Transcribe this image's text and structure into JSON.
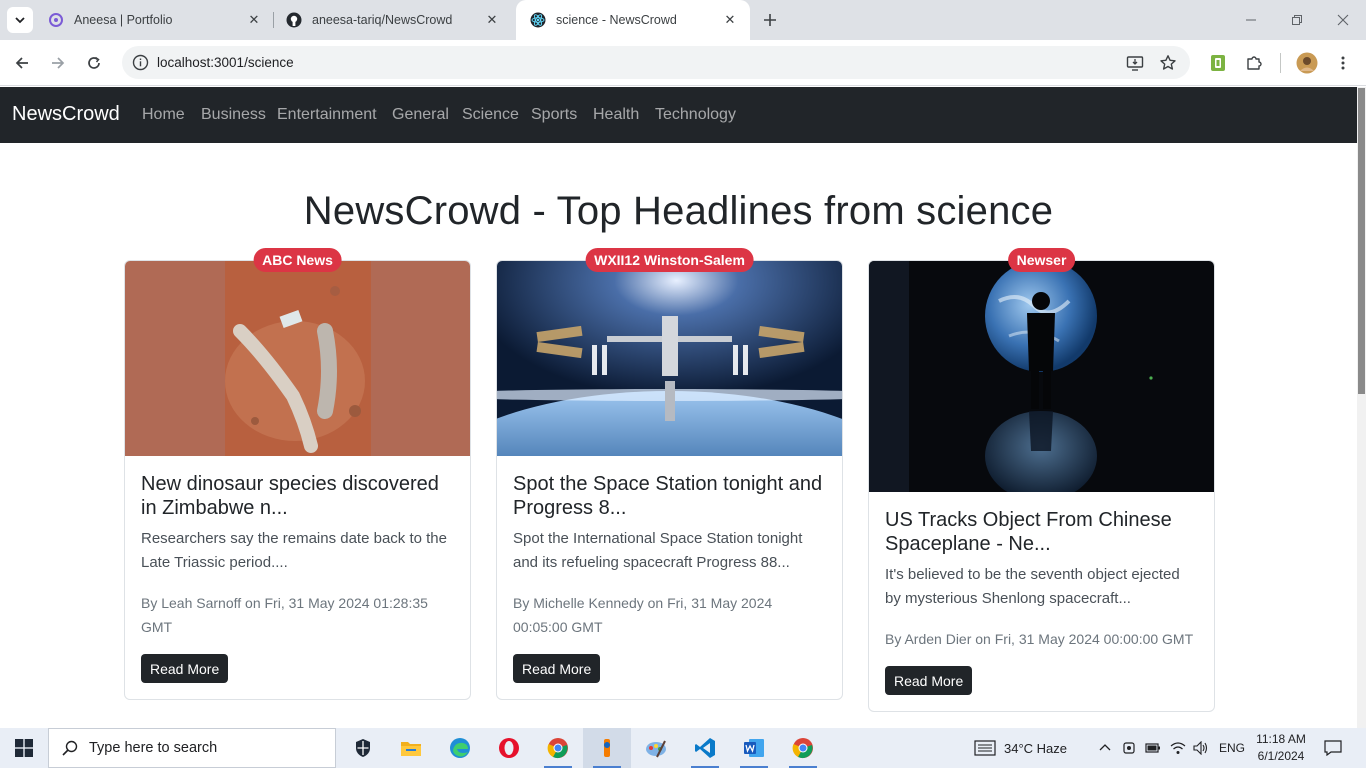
{
  "browser": {
    "tabs": [
      {
        "title": "Aneesa | Portfolio",
        "favicon": "portfolio-icon"
      },
      {
        "title": "aneesa-tariq/NewsCrowd",
        "favicon": "github-icon"
      },
      {
        "title": "science - NewsCrowd",
        "favicon": "react-icon",
        "active": true
      }
    ],
    "url": "localhost:3001/science"
  },
  "navbar": {
    "brand": "NewsCrowd",
    "links": [
      "Home",
      "Business",
      "Entertainment",
      "General",
      "Science",
      "Sports",
      "Health",
      "Technology"
    ]
  },
  "page": {
    "title": "NewsCrowd - Top Headlines from science",
    "read_more": "Read More"
  },
  "articles": [
    {
      "source": "ABC News",
      "title": "New dinosaur species discovered in Zimbabwe n...",
      "description": "Researchers say the remains date back to the Late Triassic period....",
      "meta": "By Leah Sarnoff on Fri, 31 May 2024 01:28:35 GMT",
      "image": "fossil-photo"
    },
    {
      "source": "WXII12 Winston-Salem",
      "title": "Spot the Space Station tonight and Progress 8...",
      "description": "Spot the International Space Station tonight and its refueling spacecraft Progress 88...",
      "meta": "By Michelle Kennedy on Fri, 31 May 2024 00:05:00 GMT",
      "image": "space-station-photo"
    },
    {
      "source": "Newser",
      "title": "US Tracks Object From Chinese Spaceplane - Ne...",
      "description": "It's believed to be the seventh object ejected by mysterious Shenlong spacecraft...",
      "meta": "By Arden Dier on Fri, 31 May 2024 00:00:00 GMT",
      "image": "earth-silhouette-photo"
    }
  ],
  "taskbar": {
    "search_placeholder": "Type here to search",
    "weather": "34°C  Haze",
    "language": "ENG",
    "time": "11:18 AM",
    "date": "6/1/2024"
  },
  "colors": {
    "navbar_bg": "#212529",
    "badge_bg": "#dc3545",
    "button_bg": "#212529"
  }
}
